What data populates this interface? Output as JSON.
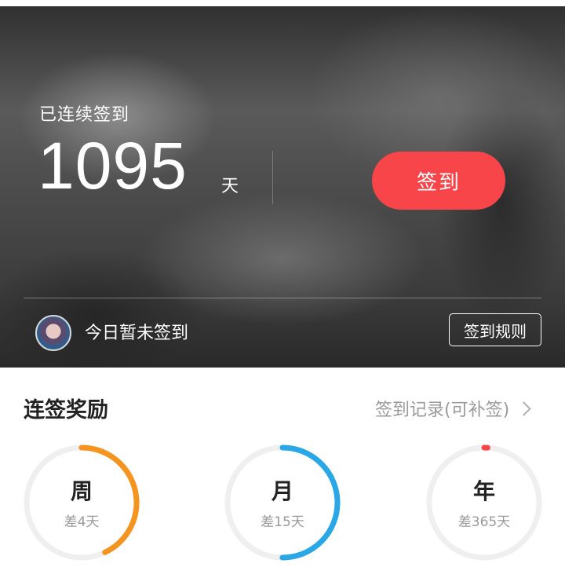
{
  "hero": {
    "streak_label": "已连续签到",
    "streak_count": "1095",
    "streak_unit": "天",
    "checkin_button": "签到",
    "today_status": "今日暂未签到",
    "rules_button": "签到规则"
  },
  "rewards": {
    "title": "连签奖励",
    "record_link": "签到记录(可补签)",
    "items": [
      {
        "label": "周",
        "remaining": "差4天",
        "color": "#f5941e",
        "progress": 0.43
      },
      {
        "label": "月",
        "remaining": "差15天",
        "color": "#2aa7e6",
        "progress": 0.5
      },
      {
        "label": "年",
        "remaining": "差365天",
        "color": "#f74549",
        "progress": 0.01
      }
    ]
  },
  "colors": {
    "accent": "#f74549",
    "ring_track": "#efefef"
  },
  "icons": [
    "avatar",
    "chevron-right-icon"
  ]
}
